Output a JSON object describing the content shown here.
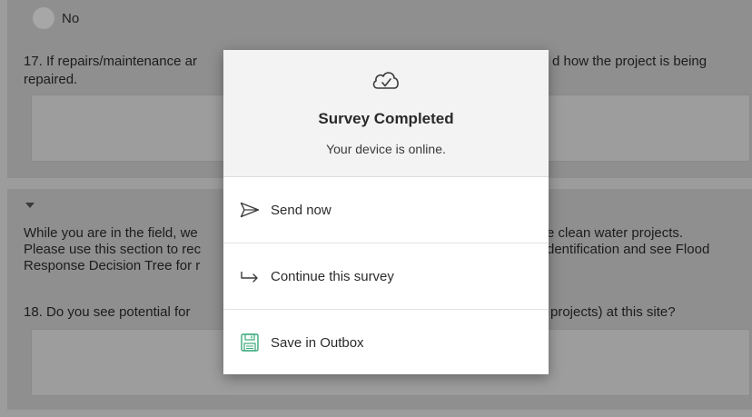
{
  "form": {
    "radio_no_label": "No",
    "q17_line1_left": "17. If repairs/maintenance ar",
    "q17_line1_right": "d how the project is being",
    "q17_line2": "repaired.",
    "section_para_line1_left": "While you are in the field, we",
    "section_para_line1_right": "e clean water projects.",
    "section_para_line2_left": "Please use this section to rec",
    "section_para_line2_right": "dentification and see Flood",
    "section_para_line3_left": "Response Decision Tree for r",
    "q18_left": "18. Do you see potential for",
    "q18_right": "projects) at this site?"
  },
  "modal": {
    "icon": "cloud-check-icon",
    "title": "Survey Completed",
    "subtitle": "Your device is online.",
    "actions": [
      {
        "label": "Send now",
        "icon": "send-icon"
      },
      {
        "label": "Continue this survey",
        "icon": "continue-arrow-icon"
      },
      {
        "label": "Save in Outbox",
        "icon": "save-floppy-icon"
      }
    ]
  },
  "colors": {
    "accent_green": "#3aa97a",
    "overlay_gray": "#9c9c9c"
  }
}
